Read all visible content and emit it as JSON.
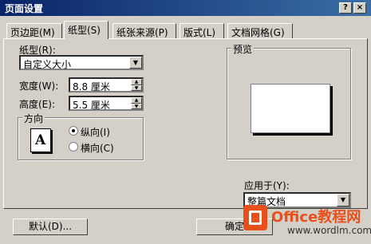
{
  "window": {
    "title": "页面设置",
    "help_btn": "?",
    "close_btn": "×"
  },
  "tabs": [
    {
      "label": "页边距(M)"
    },
    {
      "label": "纸型(S)"
    },
    {
      "label": "纸张来源(P)"
    },
    {
      "label": "版式(L)"
    },
    {
      "label": "文档网格(G)"
    }
  ],
  "paper": {
    "size_label": "纸型(R):",
    "size_value": "自定义大小",
    "width_label": "宽度(W):",
    "width_value": "8.8 厘米",
    "height_label": "高度(E):",
    "height_value": "5.5 厘米",
    "orientation_label": "方向",
    "portrait_label": "纵向(I)",
    "landscape_label": "横向(C)",
    "orientation_selected": "portrait",
    "orientation_icon": "A"
  },
  "preview": {
    "label": "预览"
  },
  "apply": {
    "label": "应用于(Y):",
    "value": "整篇文档"
  },
  "buttons": {
    "default": "默认(D)...",
    "ok": "确定"
  },
  "watermark": {
    "brand": "Office教程网",
    "url": "www.wordlm.com"
  }
}
